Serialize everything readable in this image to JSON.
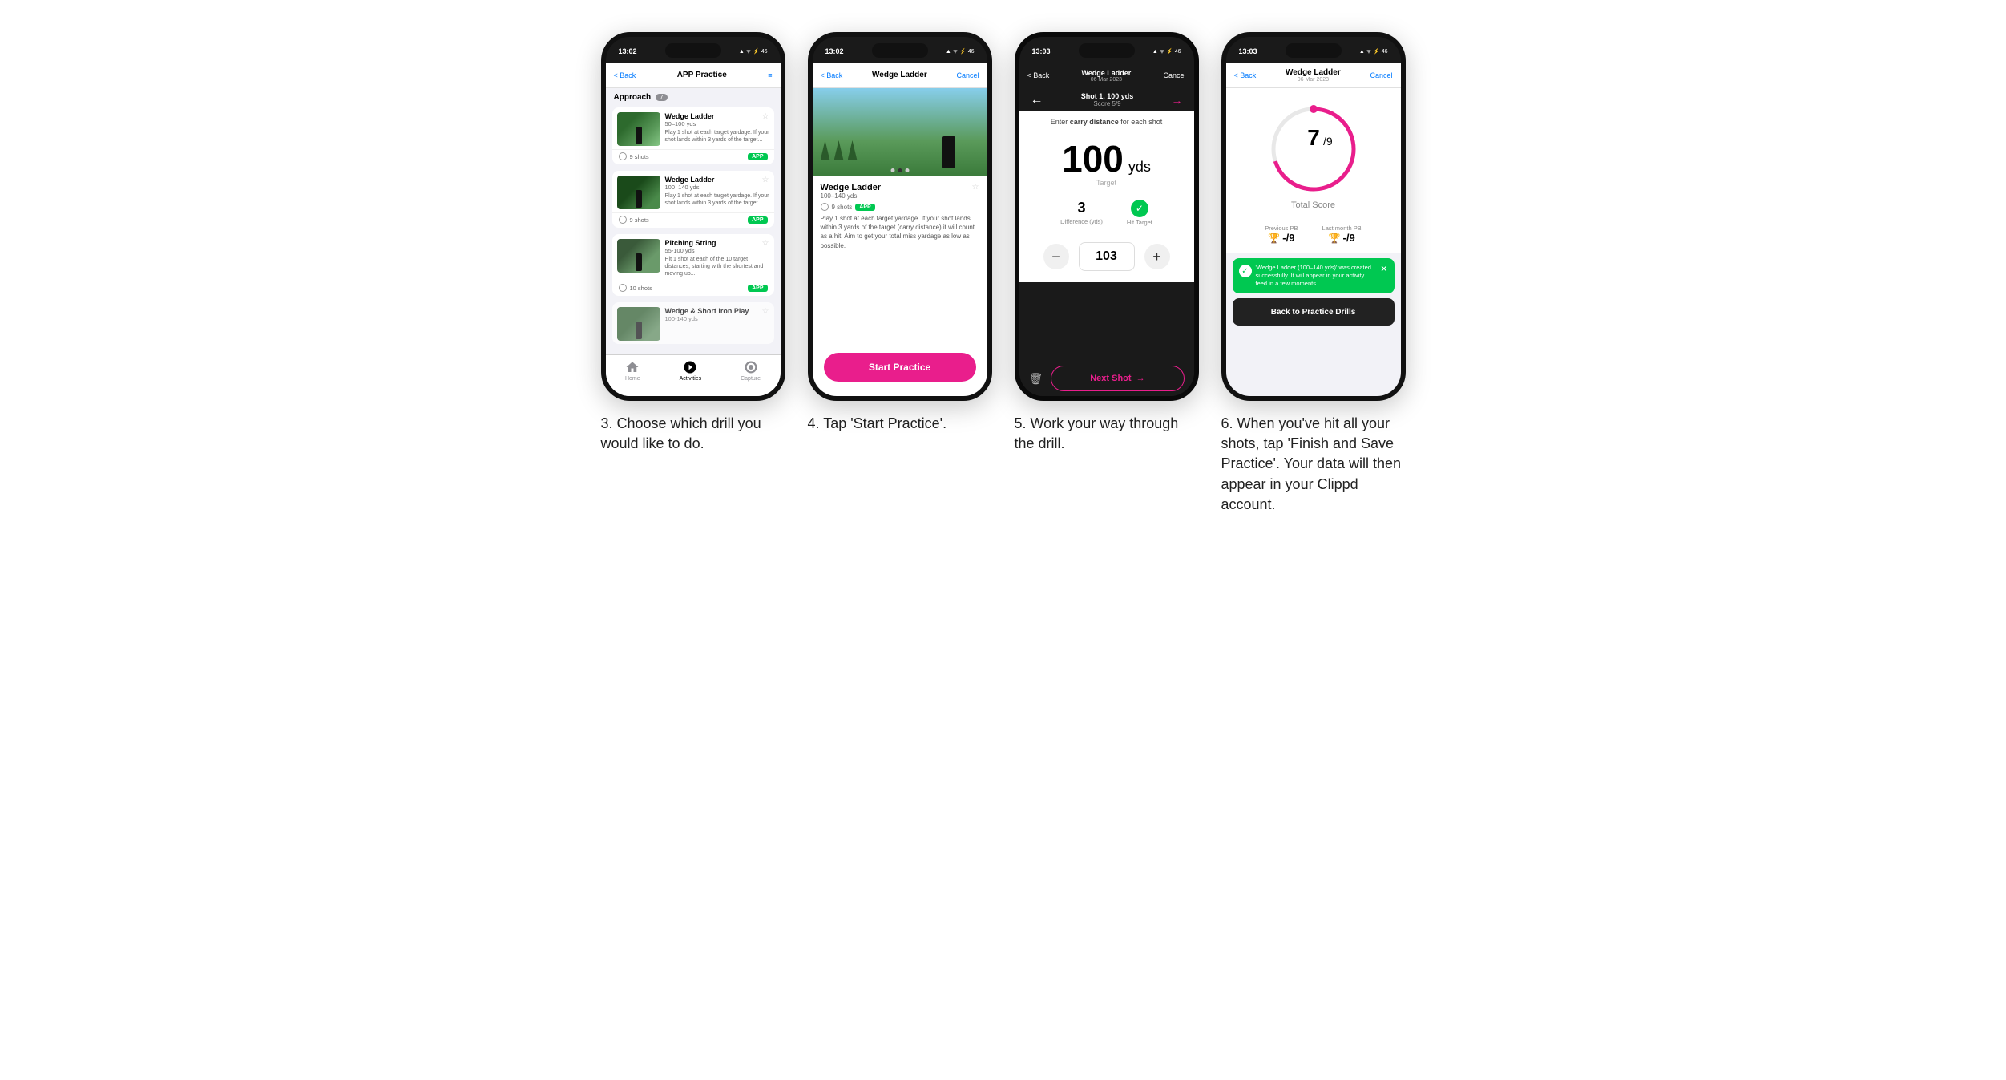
{
  "phones": [
    {
      "id": "phone1",
      "time": "13:02",
      "nav": {
        "back": "< Back",
        "title": "APP Practice",
        "right": "≡"
      },
      "section": {
        "label": "Approach",
        "count": "7"
      },
      "cards": [
        {
          "title": "Wedge Ladder",
          "range": "50–100 yds",
          "desc": "Play 1 shot at each target yardage. If your shot lands within 3 yards of the target...",
          "shots": "9 shots",
          "badge": "APP"
        },
        {
          "title": "Wedge Ladder",
          "range": "100–140 yds",
          "desc": "Play 1 shot at each target yardage. If your shot lands within 3 yards of the target...",
          "shots": "9 shots",
          "badge": "APP"
        },
        {
          "title": "Pitching String",
          "range": "55-100 yds",
          "desc": "Hit 1 shot at each of the 10 target distances, starting with the shortest and moving up...",
          "shots": "10 shots",
          "badge": "APP"
        },
        {
          "title": "Wedge & Short Iron Play",
          "range": "100-140 yds",
          "desc": "",
          "shots": "",
          "badge": ""
        }
      ],
      "tabs": [
        {
          "label": "Home",
          "active": false
        },
        {
          "label": "Activities",
          "active": true
        },
        {
          "label": "Capture",
          "active": false
        }
      ]
    },
    {
      "id": "phone2",
      "time": "13:02",
      "nav": {
        "back": "< Back",
        "title": "Wedge Ladder",
        "right": "Cancel"
      },
      "drill": {
        "title": "Wedge Ladder",
        "range": "100–140 yds",
        "shots": "9 shots",
        "badge": "APP",
        "desc": "Play 1 shot at each target yardage. If your shot lands within 3 yards of the target (carry distance) it will count as a hit. Aim to get your total miss yardage as low as possible."
      },
      "start_btn": "Start Practice"
    },
    {
      "id": "phone3",
      "time": "13:03",
      "nav": {
        "back": "< Back",
        "title": "Wedge Ladder",
        "subtitle": "06 Mar 2023",
        "right": "Cancel"
      },
      "shot": {
        "label": "Shot 1, 100 yds",
        "score": "Score 5/9"
      },
      "instruction": "Enter carry distance for each shot",
      "target": {
        "value": "100",
        "unit": "yds",
        "label": "Target"
      },
      "stats": {
        "difference": "3",
        "difference_label": "Difference (yds)",
        "hit_target": "Hit Target"
      },
      "input_value": "103",
      "next_btn": "Next Shot"
    },
    {
      "id": "phone4",
      "time": "13:03",
      "nav": {
        "back": "< Back",
        "title": "Wedge Ladder",
        "subtitle": "06 Mar 2023",
        "right": "Cancel"
      },
      "score": {
        "value": "7",
        "total": "9",
        "label": "Total Score"
      },
      "pb": {
        "previous_label": "Previous PB",
        "previous_val": "-/9",
        "last_month_label": "Last month PB",
        "last_month_val": "-/9"
      },
      "toast": {
        "text": "'Wedge Ladder (100–140 yds)' was created successfully. It will appear in your activity feed in a few moments.",
        "close": "✕"
      },
      "back_btn": "Back to Practice Drills"
    }
  ],
  "captions": [
    "3. Choose which drill you would like to do.",
    "4. Tap 'Start Practice'.",
    "5. Work your way through the drill.",
    "6. When you've hit all your shots, tap 'Finish and Save Practice'. Your data will then appear in your Clippd account."
  ]
}
